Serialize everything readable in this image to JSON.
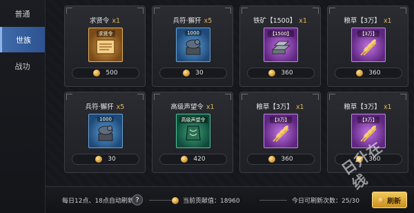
{
  "sidebar": {
    "items": [
      {
        "label": "普通",
        "active": false
      },
      {
        "label": "世族",
        "active": true
      },
      {
        "label": "战功",
        "active": false
      }
    ]
  },
  "shop": {
    "items": [
      {
        "name": "求贤令",
        "qty": "x1",
        "tag": "求贤令",
        "price": "500",
        "rarity": "gold",
        "icon": "scroll-icon"
      },
      {
        "name": "兵符·獬犴",
        "qty": "x5",
        "tag": "1000",
        "price": "30",
        "rarity": "blue",
        "icon": "beast-seal-icon"
      },
      {
        "name": "铁矿【1500】",
        "qty": "x1",
        "tag": "【1500】",
        "price": "360",
        "rarity": "purple",
        "icon": "iron-ingot-icon"
      },
      {
        "name": "粮草【3万】",
        "qty": "x1",
        "tag": "【3万】",
        "price": "360",
        "rarity": "purple",
        "icon": "grain-icon"
      },
      {
        "name": "兵符·獬犴",
        "qty": "x5",
        "tag": "1000",
        "price": "30",
        "rarity": "blue",
        "icon": "beast-seal-icon"
      },
      {
        "name": "高级声望令",
        "qty": "x1",
        "tag": "高级声望令",
        "price": "420",
        "rarity": "green",
        "icon": "prestige-token-icon"
      },
      {
        "name": "粮草【3万】",
        "qty": "x1",
        "tag": "【3万】",
        "price": "360",
        "rarity": "purple",
        "icon": "grain-icon"
      },
      {
        "name": "粮草【3万】",
        "qty": "x1",
        "tag": "【3万】",
        "price": "360",
        "rarity": "purple",
        "icon": "grain-icon"
      }
    ]
  },
  "footer": {
    "refresh_note": "每日12点、18点自动刷新",
    "help": "?",
    "contrib_label": "当前贡献值：18960",
    "remain_label": "今日可刷新次数：25/30",
    "refresh_button": "刷新"
  },
  "watermark": "日升在线",
  "colors": {
    "active_tab": "#3f6aa8",
    "qty": "#e1b85f",
    "coin": "#d3962a",
    "button": "#e0ab3a"
  }
}
